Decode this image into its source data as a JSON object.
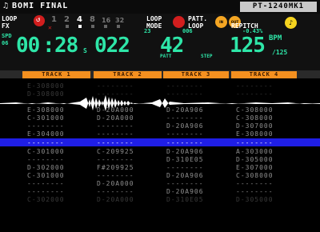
{
  "header": {
    "note_icon": "♫",
    "title": "BOMI FINAL",
    "model": "PT-1240MK1"
  },
  "panel": {
    "loop_label": "LOOP",
    "fx_label": "FX",
    "loop_steps": [
      "1",
      "2",
      "4",
      "8",
      "16",
      "32"
    ],
    "loop_mode_label": "LOOP",
    "loop_mode_label2": "MODE",
    "patt_label": "PATT.",
    "patt_label2": "LOOP",
    "in_label": "IN",
    "out_label": "OUT",
    "repitch_label": "REPITCH",
    "spd_label": "SPD",
    "spd_value": "06",
    "time_min": "00",
    "time_sec": "28",
    "time_unit": "S",
    "pos_value": "022",
    "pos_top": "23",
    "patt_num": "42",
    "patt_top": "006",
    "step_label": "STEP",
    "patt_small_label": "PATT",
    "bpm_value": "125",
    "bpm_label": "BPM",
    "bpm_sub": "/125",
    "pitch_value": "-0.43%"
  },
  "tracks": [
    "TRACK 1",
    "TRACK 2",
    "TRACK 3",
    "TRACK 4"
  ],
  "pattern_rows": [
    {
      "cells": [
        "E-308000",
        "--------",
        "--------",
        "--------"
      ],
      "state": "dim"
    },
    {
      "cells": [
        "D-308000",
        "--------",
        "--------",
        "--------"
      ],
      "state": "dim"
    },
    {
      "cells": [
        "E-308000",
        "D-20A000",
        "D-20A906",
        "C-308000"
      ],
      "state": "normal"
    },
    {
      "cells": [
        "C-301000",
        "D-20A000",
        "--------",
        "C-308000"
      ],
      "state": "normal"
    },
    {
      "cells": [
        "--------",
        "--------",
        "D-20A906",
        "D-307000"
      ],
      "state": "normal"
    },
    {
      "cells": [
        "E-304000",
        "--------",
        "--------",
        "E-308000"
      ],
      "state": "normal"
    },
    {
      "cells": [
        "--------",
        "--------",
        "--------",
        "--------"
      ],
      "state": "current"
    },
    {
      "cells": [
        "C-301000",
        "C-209925",
        "D-20A906",
        "A-303000"
      ],
      "state": "normal"
    },
    {
      "cells": [
        "--------",
        "--------",
        "D-310E05",
        "D-305000"
      ],
      "state": "normal"
    },
    {
      "cells": [
        "D-302000",
        "F#209925",
        "--------",
        "E-307000"
      ],
      "state": "normal"
    },
    {
      "cells": [
        "C-301000",
        "--------",
        "D-20A906",
        "C-308000"
      ],
      "state": "normal"
    },
    {
      "cells": [
        "--------",
        "D-20A000",
        "--------",
        "--------"
      ],
      "state": "normal"
    },
    {
      "cells": [
        "--------",
        "--------",
        "D-20A906",
        "--------"
      ],
      "state": "normal"
    },
    {
      "cells": [
        "C-302000",
        "D-20A000",
        "D-310E05",
        "D-305000"
      ],
      "state": "dim"
    },
    {
      "cells": [
        "--------",
        "--------",
        "--------",
        "--------"
      ],
      "state": "dim"
    }
  ],
  "colors": {
    "accent_cyan": "#2ee6a8",
    "track_orange": "#f5901f",
    "current_row_blue": "#1f1ee6",
    "loop_red": "#d21e1e"
  }
}
